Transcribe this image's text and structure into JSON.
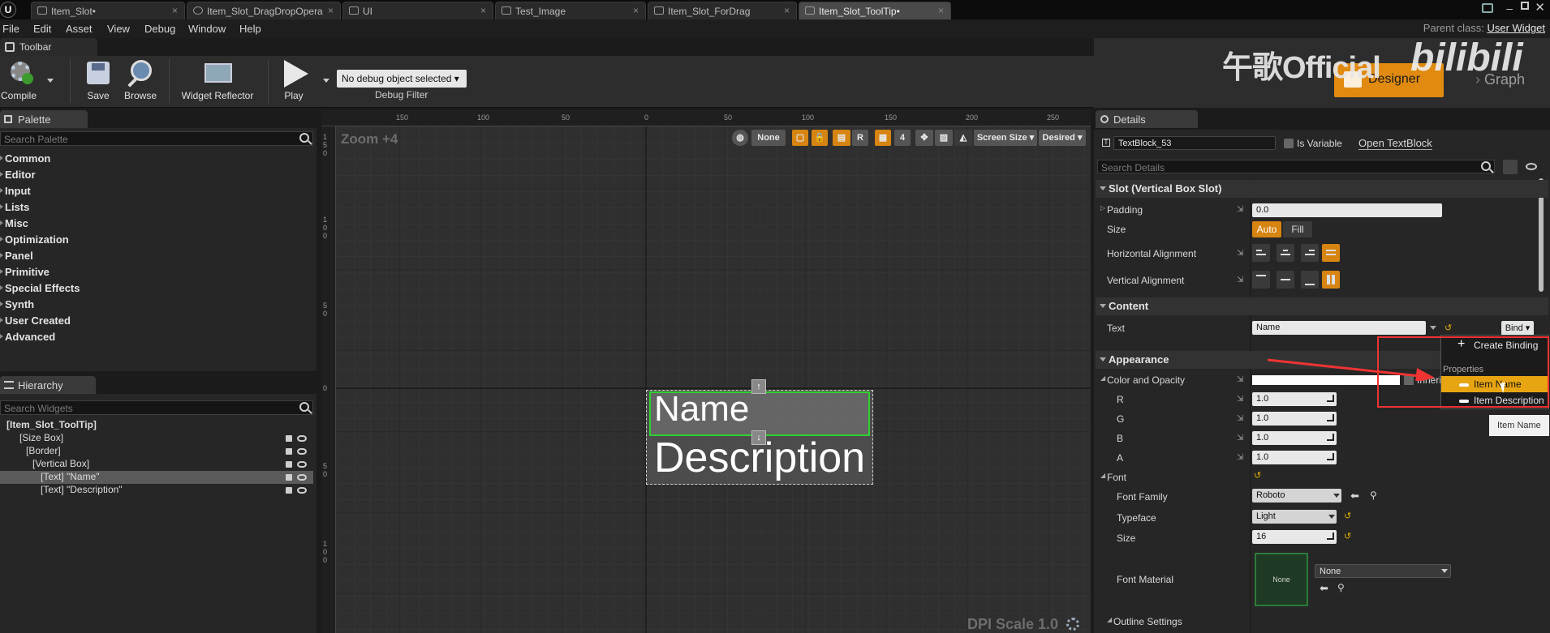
{
  "tabs": [
    "Item_Slot•",
    "Item_Slot_DragDropOpera",
    "UI",
    "Test_Image",
    "Item_Slot_ForDrag",
    "Item_Slot_ToolTip•"
  ],
  "menu": [
    "File",
    "Edit",
    "Asset",
    "View",
    "Debug",
    "Window",
    "Help"
  ],
  "parent_class": {
    "label": "Parent class:",
    "value": "User Widget"
  },
  "toolbar": {
    "tab": "Toolbar",
    "compile": "Compile",
    "save": "Save",
    "browse": "Browse",
    "widget_reflector": "Widget Reflector",
    "play": "Play",
    "debug_select": "No debug object selected ▾",
    "debug_filter": "Debug Filter"
  },
  "modes": {
    "designer": "Designer",
    "graph": "Graph"
  },
  "watermark": {
    "text": "午歌Official",
    "brand": "bilibili"
  },
  "palette": {
    "tab": "Palette",
    "search_placeholder": "Search Palette",
    "categories": [
      "Common",
      "Editor",
      "Input",
      "Lists",
      "Misc",
      "Optimization",
      "Panel",
      "Primitive",
      "Special Effects",
      "Synth",
      "User Created",
      "Advanced"
    ]
  },
  "hierarchy": {
    "tab": "Hierarchy",
    "search_placeholder": "Search Widgets",
    "items": [
      "[Item_Slot_ToolTip]",
      "[Size Box]",
      "[Border]",
      "[Vertical Box]",
      "[Text] \"Name\"",
      "[Text] \"Description\""
    ]
  },
  "viewport": {
    "zoom": "Zoom +4",
    "dpi": "DPI Scale 1.0",
    "none_btn": "None",
    "r_btn": "R",
    "grid_num": "4",
    "screen_size": "Screen Size ▾",
    "desired": "Desired ▾",
    "ruler_top": [
      "150",
      "100",
      "50",
      "0",
      "50",
      "100",
      "150",
      "200",
      "250"
    ],
    "ruler_left": [
      "150",
      "100",
      "50",
      "0",
      "50",
      "100"
    ],
    "name_text": "Name",
    "desc_text": "Description"
  },
  "details": {
    "tab": "Details",
    "widget_name": "TextBlock_53",
    "is_variable": "Is Variable",
    "open_textblock": "Open TextBlock",
    "search_placeholder": "Search Details",
    "slot_header": "Slot (Vertical Box Slot)",
    "padding_label": "Padding",
    "padding_value": "0.0",
    "size_label": "Size",
    "size_auto": "Auto",
    "size_fill": "Fill",
    "halign_label": "Horizontal Alignment",
    "valign_label": "Vertical Alignment",
    "content_header": "Content",
    "text_label": "Text",
    "text_value": "Name",
    "bind": "Bind ▾",
    "appearance_header": "Appearance",
    "color_label": "Color and Opacity",
    "inherit": "Inherit",
    "r_label": "R",
    "r_value": "1.0",
    "g_label": "G",
    "g_value": "1.0",
    "b_label": "B",
    "b_value": "1.0",
    "a_label": "A",
    "a_value": "1.0",
    "font_label": "Font",
    "font_family_label": "Font Family",
    "font_family": "Roboto",
    "typeface_label": "Typeface",
    "typeface": "Light",
    "size_font_label": "Size",
    "font_size": "16",
    "font_material_label": "Font Material",
    "material_thumb": "None",
    "material_value": "None",
    "outline_label": "Outline Settings"
  },
  "binding_popup": {
    "create": "Create Binding",
    "section": "Properties",
    "items": [
      "Item Name",
      "Item Description"
    ],
    "tooltip": "Item Name"
  },
  "colors": {
    "accent": "#e08a10",
    "select_green": "#2fd12f",
    "outline_red": "#e33333"
  }
}
